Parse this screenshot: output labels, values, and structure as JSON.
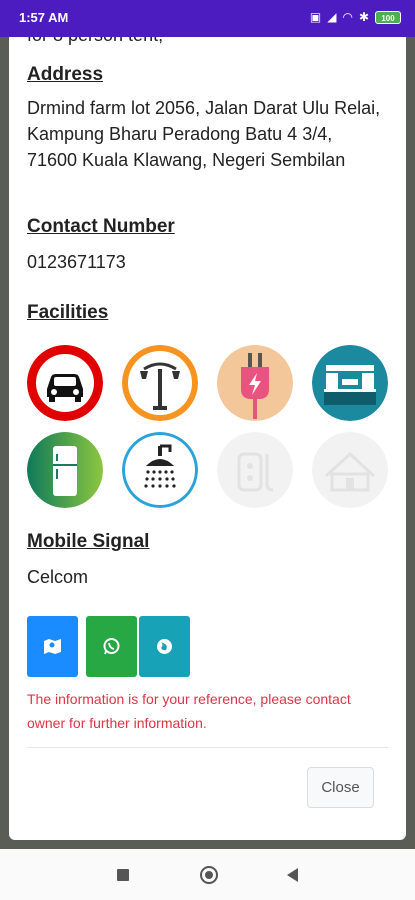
{
  "status": {
    "time": "1:57 AM",
    "battery": "100"
  },
  "top_cut_text": "for 8 person tent,",
  "address": {
    "heading": "Address",
    "text": "Drmind farm lot 2056, Jalan Darat Ulu Relai, Kampung Bharu Peradong Batu 4 3/4, 71600 Kuala Klawang, Negeri Sembilan"
  },
  "contact": {
    "heading": "Contact Number",
    "number": "0123671173"
  },
  "facilities": {
    "heading": "Facilities",
    "items": [
      {
        "name": "parking",
        "available": true
      },
      {
        "name": "street-lamp",
        "available": true
      },
      {
        "name": "electricity",
        "available": true
      },
      {
        "name": "kitchen",
        "available": true
      },
      {
        "name": "refrigerator",
        "available": true
      },
      {
        "name": "shower",
        "available": true
      },
      {
        "name": "power-socket",
        "available": false
      },
      {
        "name": "shelter",
        "available": false
      }
    ]
  },
  "mobile_signal": {
    "heading": "Mobile Signal",
    "value": "Celcom"
  },
  "actions": [
    {
      "name": "map",
      "color": "#1a8cff"
    },
    {
      "name": "whatsapp",
      "color": "#28a745"
    },
    {
      "name": "website",
      "color": "#17a2b8"
    }
  ],
  "notice": "The information is for your reference, please contact owner for further information.",
  "close_label": "Close",
  "colors": {
    "status_bar": "#4c1cc0",
    "notice": "#dc3545"
  }
}
